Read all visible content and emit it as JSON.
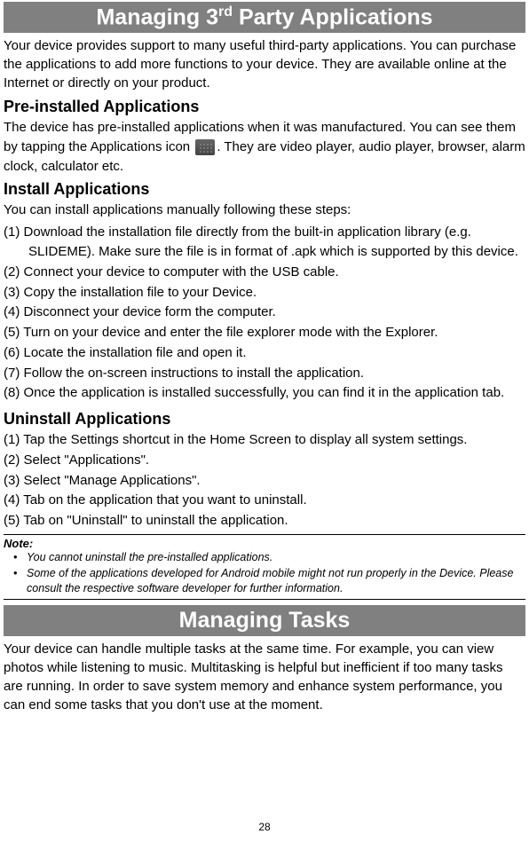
{
  "page": {
    "number": "28"
  },
  "section1": {
    "title_prefix": "Managing 3",
    "title_sup": "rd",
    "title_suffix": " Party Applications",
    "intro": "Your device provides support to many useful third-party applications. You can purchase the applications to add more functions to your device. They are available online at the Internet or directly on your product.",
    "sub1": {
      "heading": "Pre-installed Applications",
      "text_before_icon": "The device has pre-installed applications when it was manufactured. You can see them by tapping the Applications icon ",
      "text_after_icon": ". They are video player, audio player, browser, alarm clock, calculator etc."
    },
    "sub2": {
      "heading": "Install Applications",
      "intro": "You can install applications manually following these steps:",
      "steps": [
        "(1) Download the installation file directly from the built-in application library (e.g. SLIDEME). Make sure the file is in format of .apk which is supported by this device.",
        "(2) Connect your device to computer with the USB cable.",
        "(3) Copy the installation file to your Device.",
        "(4) Disconnect your device form the computer.",
        "(5) Turn on your device and enter the file explorer mode with the Explorer.",
        "(6) Locate the installation file and open it.",
        "(7) Follow the on-screen instructions to install the application.",
        "(8) Once the application is installed successfully, you can find it in the application tab."
      ]
    },
    "sub3": {
      "heading": "Uninstall Applications",
      "steps": [
        "(1) Tap the Settings shortcut in the Home Screen to display all system settings.",
        "(2) Select \"Applications\".",
        "(3) Select \"Manage Applications\".",
        "(4) Tab on the application that you want to uninstall.",
        "(5) Tab on \"Uninstall\" to uninstall the application."
      ]
    },
    "note": {
      "heading": "Note:",
      "items": [
        "You cannot uninstall the pre-installed applications.",
        "Some of the applications developed for Android mobile might not run properly in the Device. Please consult the respective software developer for further information."
      ]
    }
  },
  "section2": {
    "title": "Managing Tasks",
    "intro": "Your device can handle multiple tasks at the same time. For example, you can view photos while listening to music. Multitasking is helpful but inefficient if too many tasks are running. In order to save system memory and enhance system performance, you can end some tasks that you don't use at the moment."
  }
}
